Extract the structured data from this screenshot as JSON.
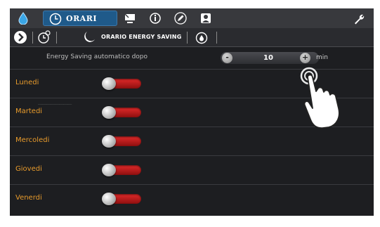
{
  "topbar": {
    "active_tab": "ORARI",
    "icons": [
      "water-drop-icon",
      "clock-icon",
      "display-icon",
      "info-icon",
      "pencil-icon",
      "user-badge-icon",
      "wrench-icon"
    ]
  },
  "subbar": {
    "label": "ORARIO ENERGY SAVING",
    "icons": [
      "chevron-right-icon",
      "clock-icon",
      "moon-icon",
      "clock-drop-icon"
    ]
  },
  "energy_saving": {
    "label": "Energy Saving automatico dopo",
    "minus_label": "-",
    "value": "10",
    "plus_label": "+",
    "unit": "min"
  },
  "days": [
    {
      "label": "Lunedi",
      "enabled": false
    },
    {
      "label": "Martedi",
      "enabled": false
    },
    {
      "label": "Mercoledi",
      "enabled": false
    },
    {
      "label": "Giovedi",
      "enabled": false
    },
    {
      "label": "Venerdi",
      "enabled": false
    }
  ],
  "colors": {
    "accent_tab": "#1f5a8a",
    "day_label": "#e89b2c",
    "toggle_off": "#c41b1b"
  }
}
